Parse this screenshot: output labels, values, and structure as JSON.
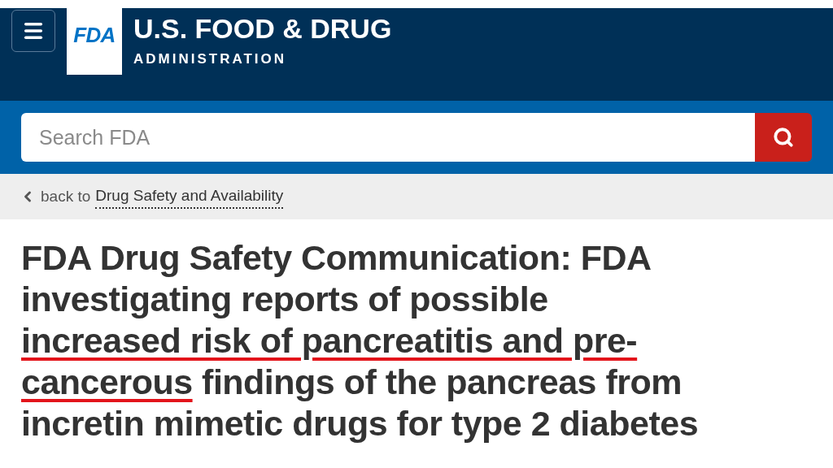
{
  "header": {
    "logo_mark": "FDA",
    "title": "U.S. FOOD & DRUG",
    "subtitle": "ADMINISTRATION"
  },
  "search": {
    "placeholder": "Search FDA"
  },
  "breadcrumb": {
    "prefix": "back to",
    "link": "Drug Safety and Availability"
  },
  "headline": {
    "lines": [
      [
        {
          "text": "FDA Drug Safety Communication: FDA",
          "underlined": false
        }
      ],
      [
        {
          "text": "investigating reports of possible",
          "underlined": false
        }
      ],
      [
        {
          "text": "increased risk of pancreatitis and pre-",
          "underlined": true
        }
      ],
      [
        {
          "text": "cancerous",
          "underlined": true
        },
        {
          "text": " findings of the pancreas from",
          "underlined": false
        }
      ],
      [
        {
          "text": "incretin mimetic drugs for type 2 diabetes",
          "underlined": false
        }
      ]
    ]
  }
}
